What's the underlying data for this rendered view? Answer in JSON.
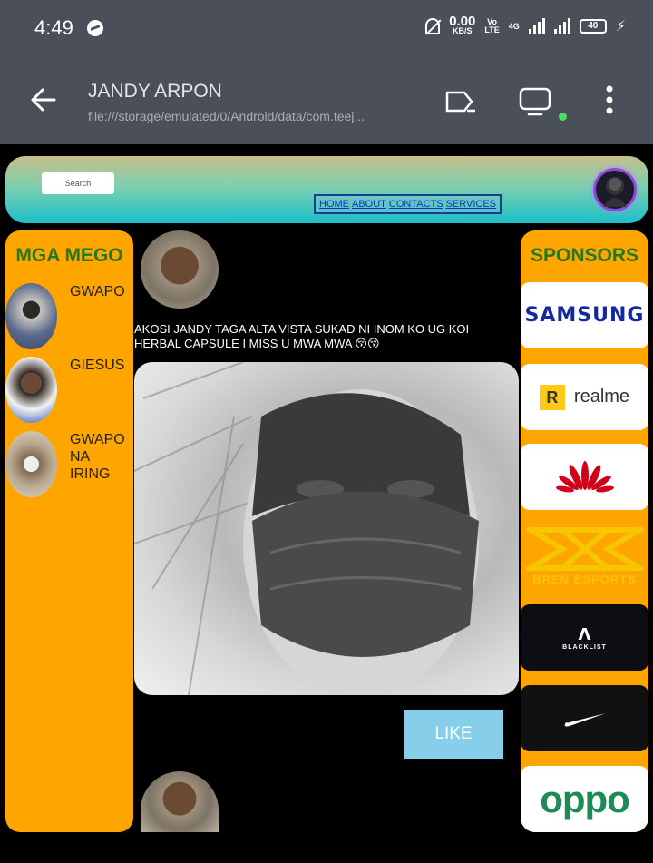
{
  "status_bar": {
    "time": "4:49",
    "speed_value": "0.00",
    "speed_unit": "KB/S",
    "volte_line1": "Vo",
    "volte_line2": "LTE",
    "network": "4G",
    "battery": "40"
  },
  "app_bar": {
    "title": "JANDY ARPON",
    "url": "file:///storage/emulated/0/Android/data/com.teej..."
  },
  "header": {
    "search_placeholder": "Search",
    "nav": [
      "HOME",
      "ABOUT",
      "CONTACTS",
      "SERVICES"
    ]
  },
  "left_panel": {
    "title": "MGA MEGO",
    "friends": [
      {
        "name": "GWAPO"
      },
      {
        "name": "GIESUS"
      },
      {
        "name": "GWAPO NA IRING"
      }
    ]
  },
  "post": {
    "text": "AKOSI JANDY TAGA ALTA VISTA SUKAD NI INOM KO UG KOI HERBAL CAPSULE I MISS U MWA MWA 😚😚",
    "like_label": "LIKE"
  },
  "right_panel": {
    "title": "SPONSORS",
    "sponsors": [
      "SAMSUNG",
      "realme",
      "HUAWEI",
      "BREN ESPORTS",
      "BLACKLIST",
      "NIKE",
      "oppo"
    ]
  },
  "colors": {
    "panel": "#ffa500",
    "panel_title": "#1f7a1f",
    "like_button": "#87ceeb",
    "toolbar": "#4a4f5a"
  }
}
